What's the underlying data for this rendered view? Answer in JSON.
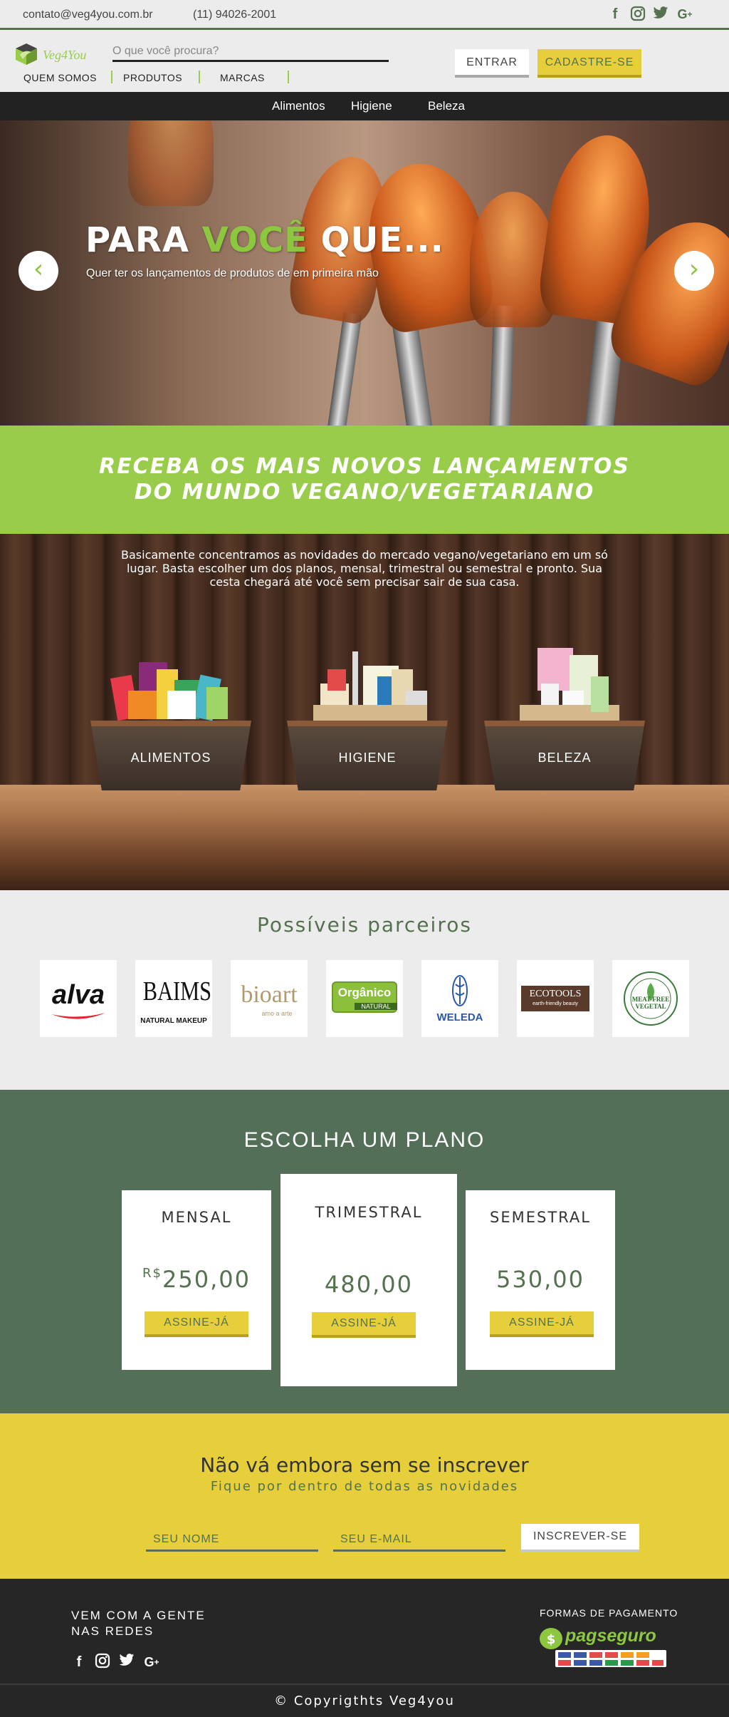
{
  "topbar": {
    "email": "contato@veg4you.com.br",
    "phone": "(11) 94026-2001",
    "social": [
      "facebook-icon",
      "instagram-icon",
      "twitter-icon",
      "google-plus-icon"
    ]
  },
  "header": {
    "logo_text": "Veg4You",
    "search_placeholder": "O que você procura?",
    "nav": [
      "QUEM SOMOS",
      "PRODUTOS",
      "MARCAS"
    ],
    "login_label": "ENTRAR",
    "signup_label": "CADASTRE-SE"
  },
  "categories": [
    "Alimentos",
    "Higiene",
    "Beleza"
  ],
  "hero": {
    "title_pre": "PARA ",
    "title_accent": "VOCÊ",
    "title_post": " QUE...",
    "subtitle": "Quer ter os lançamentos de produtos de em primeira mão",
    "prev": "‹",
    "next": "›"
  },
  "banner": {
    "line1": "RECEBA OS MAIS NOVOS LANÇAMENTOS",
    "line2": "DO MUNDO VEGANO/VEGETARIANO"
  },
  "intro": {
    "text": "Basicamente concentramos as novidades do mercado vegano/vegetariano em um só lugar. Basta escolher um dos planos, mensal, trimestral ou semestral e pronto. Sua cesta chegará até você sem precisar sair de sua casa.",
    "boxes": [
      "ALIMENTOS",
      "HIGIENE",
      "BELEZA"
    ]
  },
  "partners": {
    "title": "Possíveis parceiros",
    "logos": [
      {
        "text": "alva"
      },
      {
        "text": "BAIMS",
        "sub": "NATURAL MAKEUP"
      },
      {
        "text": "bioart",
        "sub": "amo a arte"
      },
      {
        "text": "Orgânico",
        "sub": "NATURAL"
      },
      {
        "text": "WELEDA"
      },
      {
        "text": "ECOTOOLS",
        "sub": "earth-friendly beauty"
      },
      {
        "text": "MEAT FREE VEGETAL"
      }
    ]
  },
  "plans": {
    "title": "ESCOLHA UM PLANO",
    "currency": "R$",
    "items": [
      {
        "name": "MENSAL",
        "price": "250,00",
        "cta": "ASSINE-JÁ"
      },
      {
        "name": "TRIMESTRAL",
        "price": "480,00",
        "cta": "ASSINE-JÁ"
      },
      {
        "name": "SEMESTRAL",
        "price": "530,00",
        "cta": "ASSINE-JÁ"
      }
    ]
  },
  "subscribe": {
    "title": "Não vá embora sem se inscrever",
    "subtitle": "Fique por dentro de todas as novidades",
    "name_placeholder": "SEU NOME",
    "email_placeholder": "SEU E-MAIL",
    "button": "INSCREVER-SE"
  },
  "footer": {
    "social_title_1": "VEM COM A GENTE",
    "social_title_2": "NAS REDES",
    "payments_title": "FORMAS DE PAGAMENTO",
    "pagseguro": "pagseguro",
    "copyright": "© Copyrigthts Veg4you"
  },
  "colors": {
    "accent_green": "#98cc4a",
    "dark_green": "#536f58",
    "yellow": "#e6cf3a",
    "dark": "#262626"
  }
}
